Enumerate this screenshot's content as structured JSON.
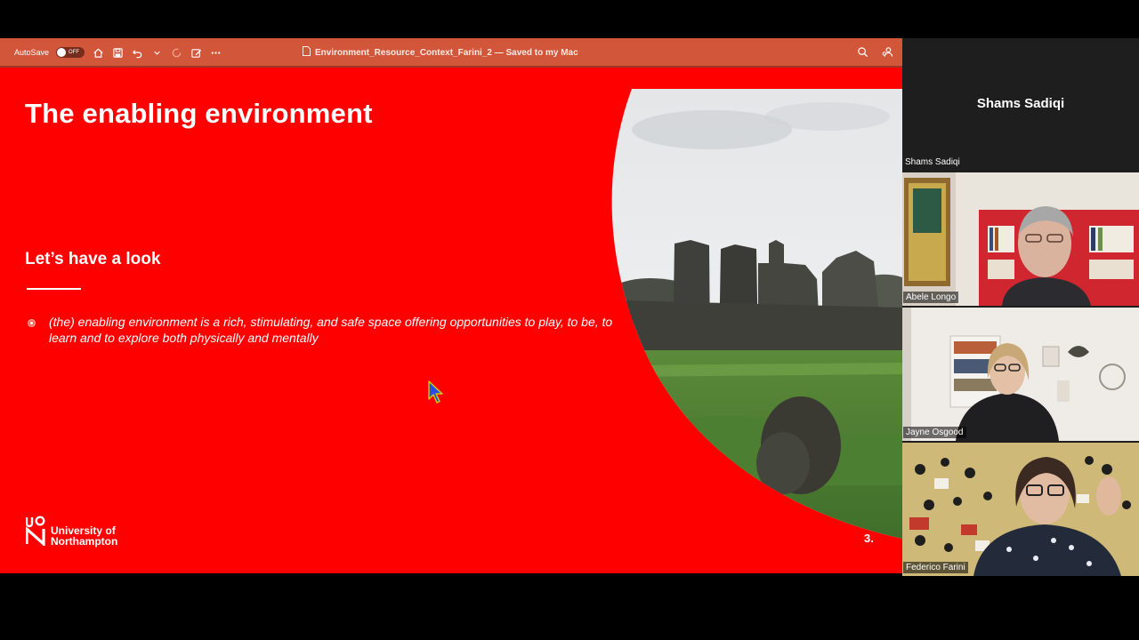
{
  "window": {
    "autosave_label": "AutoSave",
    "autosave_state": "OFF",
    "document_title": "Environment_Resource_Context_Farini_2 — Saved to my Mac",
    "accent_color": "#d2573a"
  },
  "slide": {
    "title": "The enabling environment",
    "subtitle": "Let’s have a look",
    "bullet": "(the) enabling environment is a rich, stimulating, and safe space offering opportunities to play, to be, to learn and to explore both physically and mentally",
    "logo_line1": "University of",
    "logo_line2": "Northampton",
    "slide_number": "3.",
    "background_color": "#ff0000"
  },
  "participants": {
    "active_speaker_big": "Shams Sadiqi",
    "active_speaker_label": "Shams Sadiqi",
    "tiles": [
      {
        "name": "Abele Longo"
      },
      {
        "name": "Jayne Osgood"
      },
      {
        "name": "Federico Farini"
      }
    ]
  }
}
